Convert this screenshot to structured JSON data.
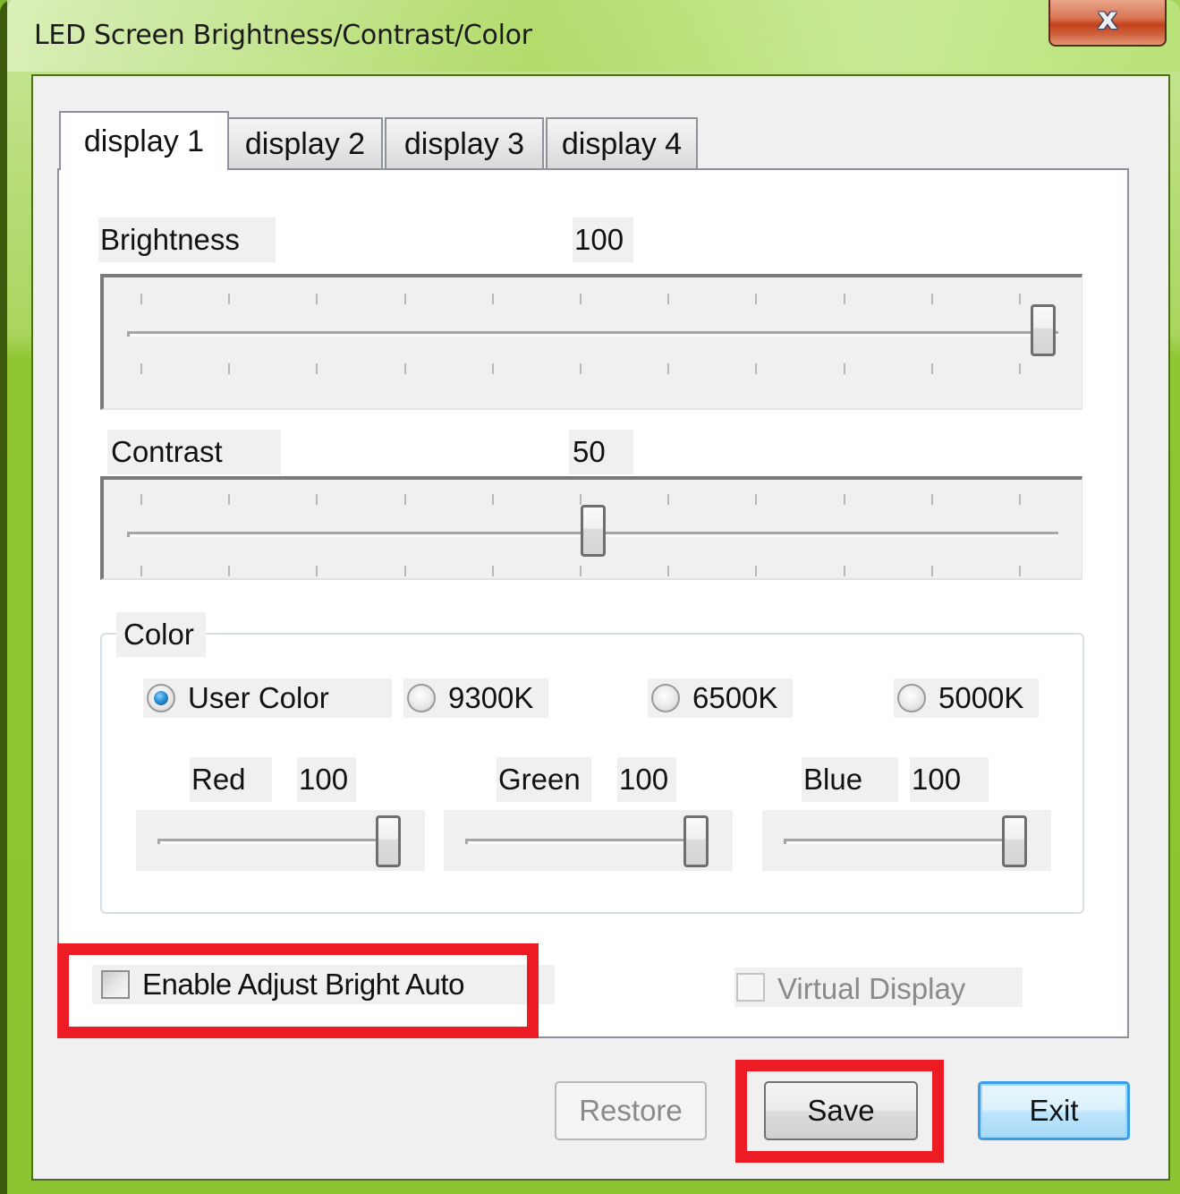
{
  "window": {
    "title": "LED Screen Brightness/Contrast/Color",
    "close_icon": "close-x-icon"
  },
  "tabs": [
    {
      "label": "display 1",
      "active": true
    },
    {
      "label": "display 2",
      "active": false
    },
    {
      "label": "display 3",
      "active": false
    },
    {
      "label": "display 4",
      "active": false
    }
  ],
  "brightness": {
    "label": "Brightness",
    "value": "100",
    "min": 0,
    "max": 100,
    "level": 100,
    "tick_count": 11
  },
  "contrast": {
    "label": "Contrast",
    "value": "50",
    "min": 0,
    "max": 100,
    "level": 50,
    "tick_count": 11
  },
  "color": {
    "group_label": "Color",
    "presets": [
      {
        "label": "User Color",
        "checked": true
      },
      {
        "label": "9300K",
        "checked": false
      },
      {
        "label": "6500K",
        "checked": false
      },
      {
        "label": "5000K",
        "checked": false
      }
    ],
    "channels": [
      {
        "label": "Red",
        "value": "100",
        "level": 100
      },
      {
        "label": "Green",
        "value": "100",
        "level": 100
      },
      {
        "label": "Blue",
        "value": "100",
        "level": 100
      }
    ]
  },
  "options": {
    "enable_auto_label": "Enable Adjust Bright Auto",
    "enable_auto_checked": false,
    "virtual_display_label": "Virtual Display",
    "virtual_display_checked": false,
    "virtual_display_enabled": false
  },
  "buttons": {
    "restore": "Restore",
    "save": "Save",
    "exit": "Exit"
  },
  "annotation_color": "#ed1c24"
}
